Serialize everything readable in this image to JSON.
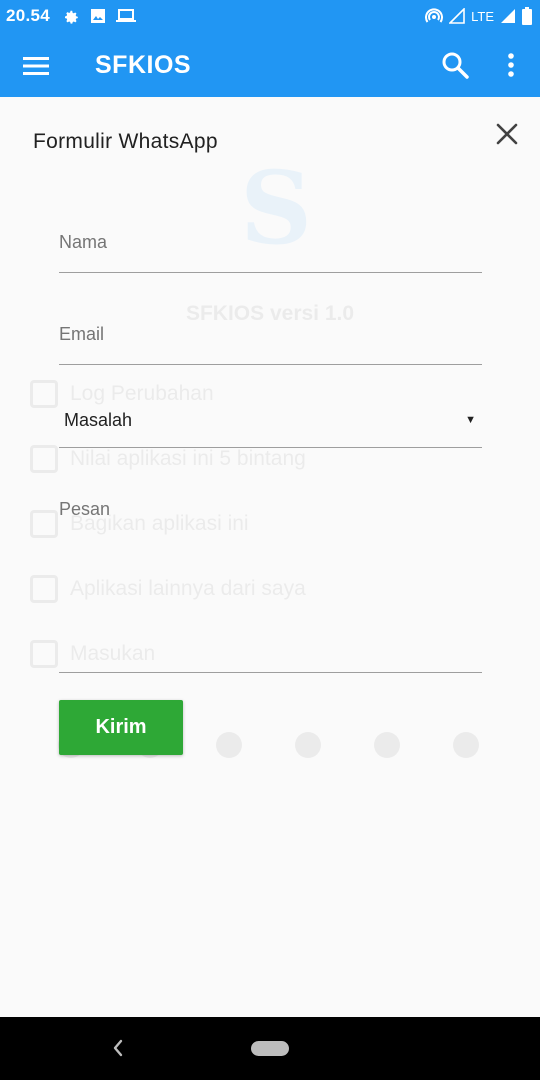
{
  "status_bar": {
    "time": "20.54",
    "network": "LTE",
    "icons": [
      "settings-icon",
      "image-icon",
      "laptop-icon",
      "hotspot-icon",
      "signal-icon",
      "battery-icon"
    ]
  },
  "app_bar": {
    "title": "SFKIOS",
    "icons": [
      "menu-icon",
      "search-icon",
      "more-vert-icon"
    ],
    "color": "#2196f3"
  },
  "background_page": {
    "version": "SFKIOS versi 1.0",
    "items": [
      "Log Perubahan",
      "Nilai aplikasi ini 5 bintang",
      "Bagikan aplikasi ini",
      "Aplikasi lainnya dari saya",
      "Masukan"
    ]
  },
  "dialog": {
    "title": "Formulir WhatsApp",
    "name_placeholder": "Nama",
    "email_placeholder": "Email",
    "select_value": "Masalah",
    "message_placeholder": "Pesan",
    "send_label": "Kirim",
    "send_color": "#2ea836"
  }
}
